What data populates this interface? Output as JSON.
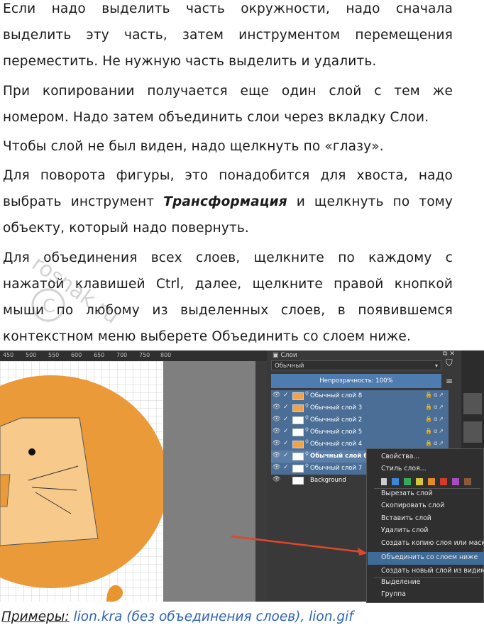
{
  "paragraphs": {
    "p1": "Если надо выделить часть окружности, надо сначала выделить эту часть, затем инструментом перемещения переместить. Не нужную часть выделить и удалить.",
    "p2": "При копировании получается еще один слой с тем же номером. Надо затем объединить слои через вкладку Слои.",
    "p3": "Чтобы слой не был виден, надо щелкнуть по «глазу».",
    "p4_before": "Для поворота фигуры, это понадобится для хвоста, надо выбрать инструмент ",
    "p4_bold": "Трансформация",
    "p4_after": " и щелкнуть по тому объекту, который надо повернуть.",
    "p5": "Для объединения всех слоев, щелкните по каждому с нажатой клавишей Ctrl, далее, щелкните правой кнопкой мыши по любому из выделенных слоев, в появившемся контекстном меню выберете Объединить со слоем ниже."
  },
  "watermark": "rosnak.ru",
  "screenshot": {
    "ruler_ticks": [
      "450",
      "500",
      "550",
      "600",
      "650",
      "700",
      "750",
      "800"
    ],
    "panel_title": "Слои",
    "blend_mode": "Обычный",
    "opacity_label": "Непрозрачность:  100%",
    "layers": [
      {
        "name": "Обычный слой 8",
        "selected": true
      },
      {
        "name": "Обычный слой 3",
        "selected": true
      },
      {
        "name": "Обычный слой 2",
        "selected": true
      },
      {
        "name": "Обычный слой 5",
        "selected": true
      },
      {
        "name": "Обычный слой 4",
        "selected": true
      },
      {
        "name": "Обычный слой 6",
        "selected": true,
        "current": true
      },
      {
        "name": "Обычный слой 7",
        "selected": true
      },
      {
        "name": "Background",
        "selected": false
      }
    ],
    "context_menu": [
      "Свойства...",
      "Стиль слоя...",
      "Вырезать слой",
      "Скопировать слой",
      "Вставить слой",
      "Удалить слой",
      "Создать копию слоя или маски",
      "Объединить со слоем ниже",
      "Создать новый слой из видимого",
      "Выделение",
      "Группа"
    ],
    "swatch_colors": [
      "#3d86d6",
      "#3aa85a",
      "#d4c83a",
      "#e08a2a",
      "#d23a2a",
      "#a84ac0",
      "#8a5a3a"
    ],
    "arrow_color": "#e0462a"
  },
  "examples": {
    "label": "Примеры:",
    "links": " lion.kra (без объединения слоев), lion.gif"
  }
}
